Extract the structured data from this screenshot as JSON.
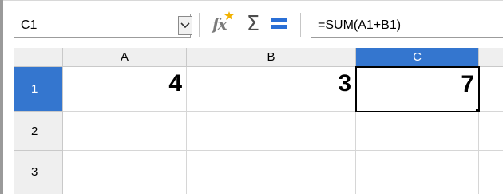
{
  "formula_bar": {
    "name_box_value": "C1",
    "formula_value": "=SUM(A1+B1)"
  },
  "icons": {
    "dropdown": "chevron-down-icon",
    "function_wizard": "fx-icon",
    "sum": "sigma-icon",
    "function": "equals-icon"
  },
  "grid": {
    "columns": [
      "A",
      "B",
      "C"
    ],
    "active_column": "C",
    "rows": [
      "1",
      "2",
      "3"
    ],
    "active_row": "1",
    "cells": {
      "A1": "4",
      "B1": "3",
      "C1": "7"
    },
    "selected_cell": "C1"
  },
  "colors": {
    "accent": "#3476cf",
    "header_bg": "#efefef",
    "equals_icon": "#2a6fd6"
  }
}
